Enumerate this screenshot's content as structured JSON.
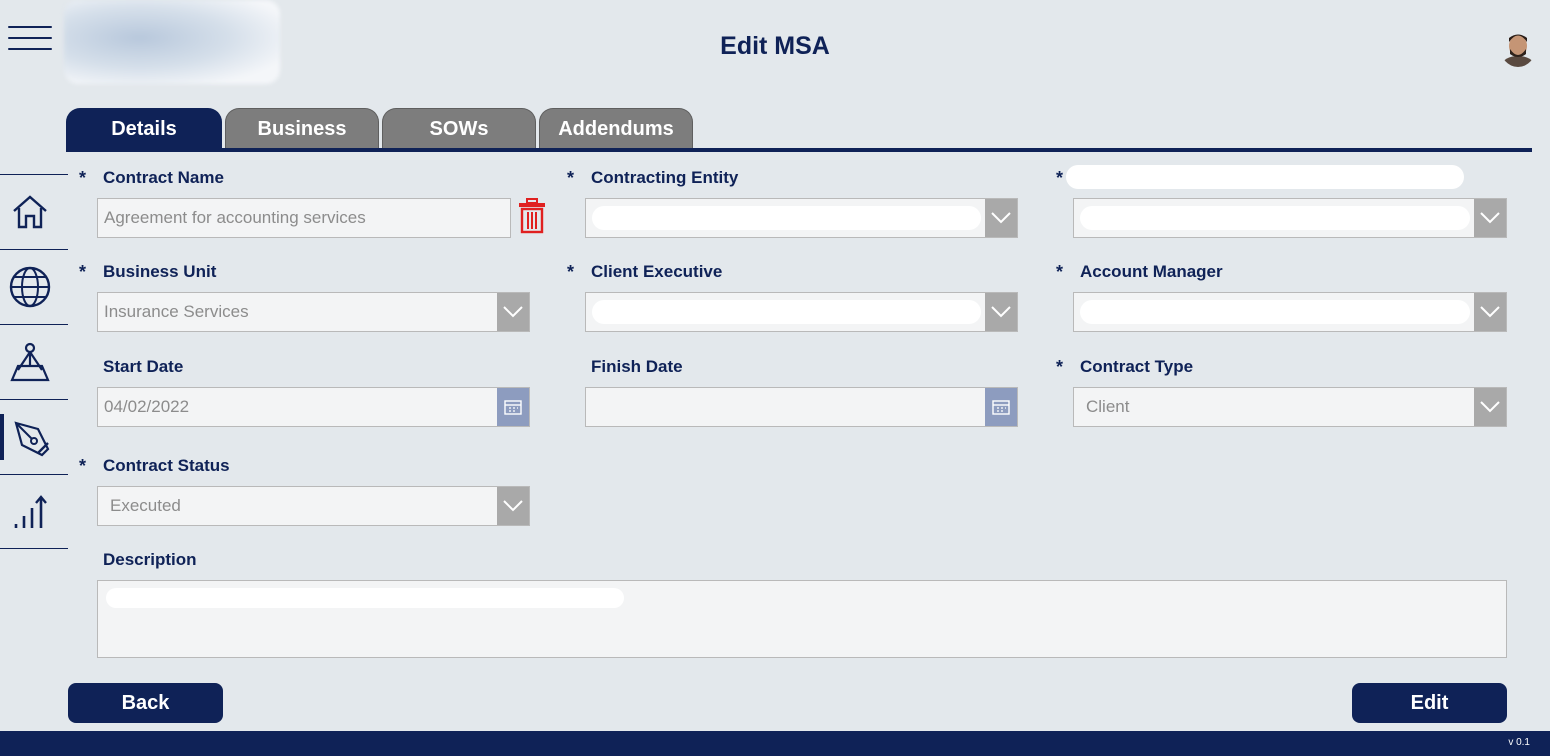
{
  "header": {
    "title": "Edit MSA"
  },
  "tabs": [
    {
      "label": "Details",
      "active": true
    },
    {
      "label": "Business",
      "active": false
    },
    {
      "label": "SOWs",
      "active": false
    },
    {
      "label": "Addendums",
      "active": false
    }
  ],
  "sidebar": {
    "items": [
      {
        "icon": "home-icon"
      },
      {
        "icon": "globe-icon"
      },
      {
        "icon": "map-pin-icon"
      },
      {
        "icon": "pen-nib-icon",
        "active": true
      },
      {
        "icon": "chart-icon"
      }
    ]
  },
  "form": {
    "required_marker": "*",
    "contract_name": {
      "label": "Contract Name",
      "value": "Agreement for accounting services"
    },
    "contracting_entity": {
      "label": "Contracting Entity",
      "value": ""
    },
    "business_unit": {
      "label": "Business Unit",
      "value": "Insurance Services"
    },
    "client_executive": {
      "label": "Client Executive",
      "value": ""
    },
    "account_manager": {
      "label": "Account Manager",
      "value": ""
    },
    "start_date": {
      "label": "Start Date",
      "value": "04/02/2022"
    },
    "finish_date": {
      "label": "Finish Date",
      "value": ""
    },
    "contract_type": {
      "label": "Contract Type",
      "value": "Client"
    },
    "contract_status": {
      "label": "Contract Status",
      "value": "Executed"
    },
    "description": {
      "label": "Description",
      "value": ""
    }
  },
  "buttons": {
    "back": "Back",
    "edit": "Edit"
  },
  "footer": {
    "version": "v 0.1"
  },
  "colors": {
    "primary": "#0f2257",
    "background": "#e3e8ec",
    "tab_inactive": "#7d7d7d",
    "delete": "#e02020"
  }
}
